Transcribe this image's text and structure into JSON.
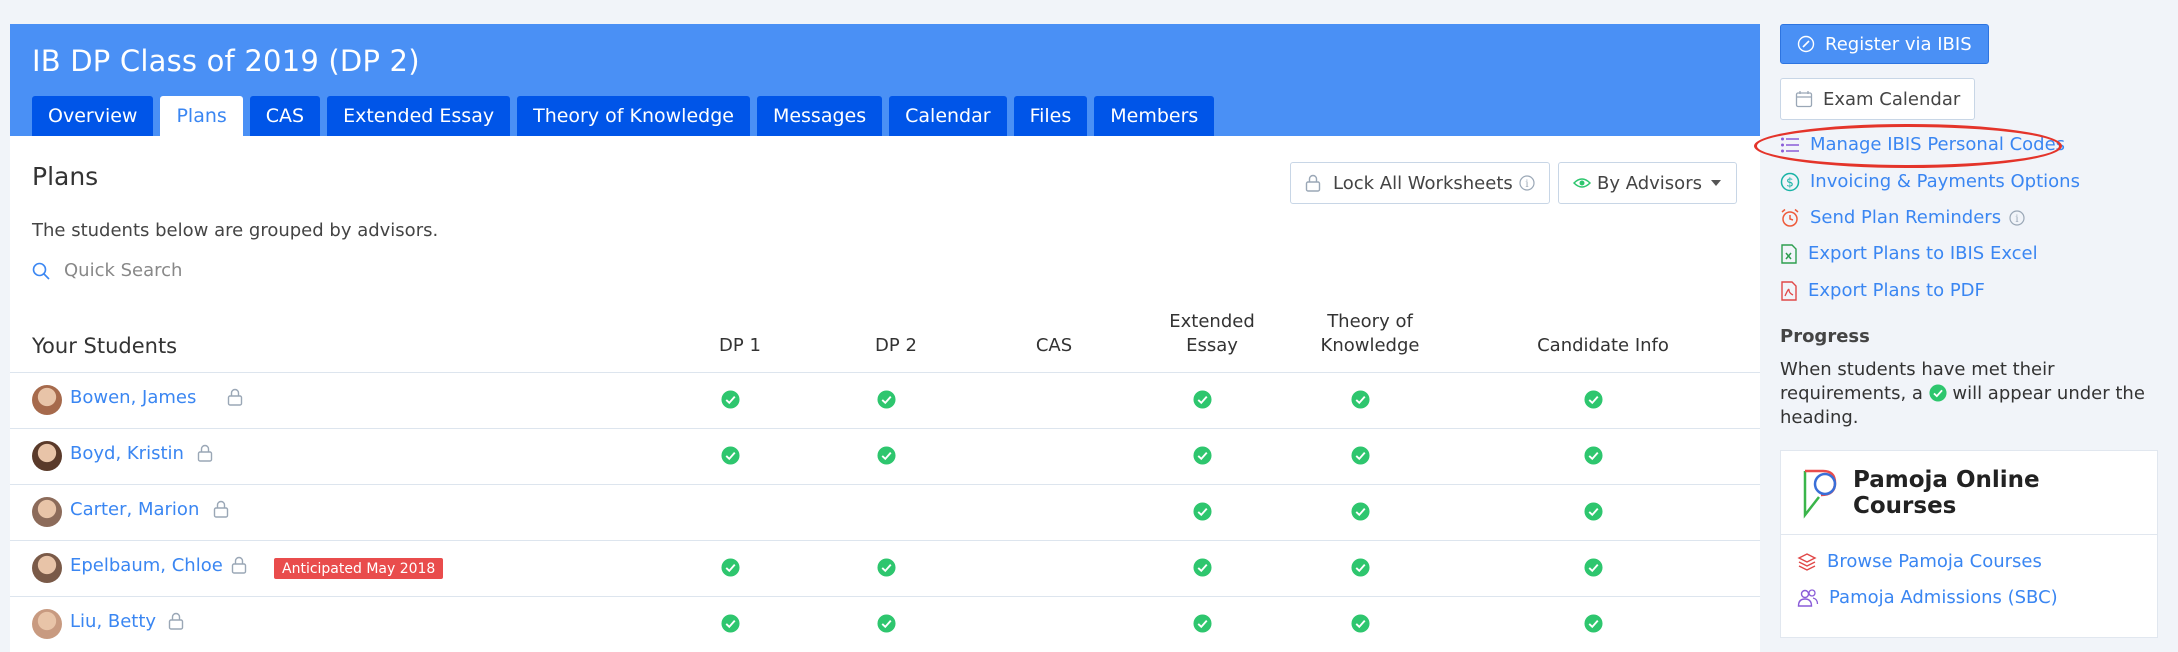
{
  "header": {
    "title": "IB DP Class of 2019 (DP 2)",
    "tabs": [
      {
        "label": "Overview",
        "active": false
      },
      {
        "label": "Plans",
        "active": true
      },
      {
        "label": "CAS",
        "active": false
      },
      {
        "label": "Extended Essay",
        "active": false
      },
      {
        "label": "Theory of Knowledge",
        "active": false
      },
      {
        "label": "Messages",
        "active": false
      },
      {
        "label": "Calendar",
        "active": false
      },
      {
        "label": "Files",
        "active": false
      },
      {
        "label": "Members",
        "active": false
      }
    ]
  },
  "plans": {
    "title": "Plans",
    "lock_button": "Lock All Worksheets",
    "group_button": "By Advisors",
    "description": "The students below are grouped by advisors.",
    "search_placeholder": "Quick Search"
  },
  "table": {
    "columns": {
      "students": "Your Students",
      "dp1": "DP 1",
      "dp2": "DP 2",
      "cas": "CAS",
      "ee_line1": "Extended",
      "ee_line2": "Essay",
      "tok_line1": "Theory of",
      "tok_line2": "Knowledge",
      "candidate": "Candidate Info"
    },
    "rows": [
      {
        "name": "Bowen, James",
        "badge": "",
        "dp1": true,
        "dp2": true,
        "cas": false,
        "ee": true,
        "tok": true,
        "candidate": true
      },
      {
        "name": "Boyd, Kristin",
        "badge": "",
        "dp1": true,
        "dp2": true,
        "cas": false,
        "ee": true,
        "tok": true,
        "candidate": true
      },
      {
        "name": "Carter, Marion",
        "badge": "",
        "dp1": false,
        "dp2": false,
        "cas": false,
        "ee": true,
        "tok": true,
        "candidate": true
      },
      {
        "name": "Epelbaum, Chloe",
        "badge": "Anticipated May 2018",
        "dp1": true,
        "dp2": true,
        "cas": false,
        "ee": true,
        "tok": true,
        "candidate": true
      },
      {
        "name": "Liu, Betty",
        "badge": "",
        "dp1": true,
        "dp2": true,
        "cas": false,
        "ee": true,
        "tok": true,
        "candidate": true
      }
    ]
  },
  "sidebar": {
    "register_button": "Register via IBIS",
    "exam_calendar_button": "Exam Calendar",
    "links": {
      "manage_codes": "Manage IBIS Personal Codes",
      "invoicing": "Invoicing & Payments Options",
      "reminders": "Send Plan Reminders",
      "export_excel": "Export Plans to IBIS Excel",
      "export_pdf": "Export Plans to PDF"
    },
    "progress_title": "Progress",
    "progress_text_before": "When students have met their requirements, a ",
    "progress_text_after": " will appear under the heading.",
    "pamoja": {
      "title_line1": "Pamoja Online",
      "title_line2": "Courses",
      "browse": "Browse Pamoja Courses",
      "admissions": "Pamoja Admissions (SBC)"
    }
  },
  "colors": {
    "header_blue": "#4a90f5",
    "tab_blue": "#0055e8",
    "link_blue": "#3a86f2",
    "check_green": "#2ec66e",
    "badge_red": "#e94c4c",
    "highlight_oval": "#e4342a"
  }
}
